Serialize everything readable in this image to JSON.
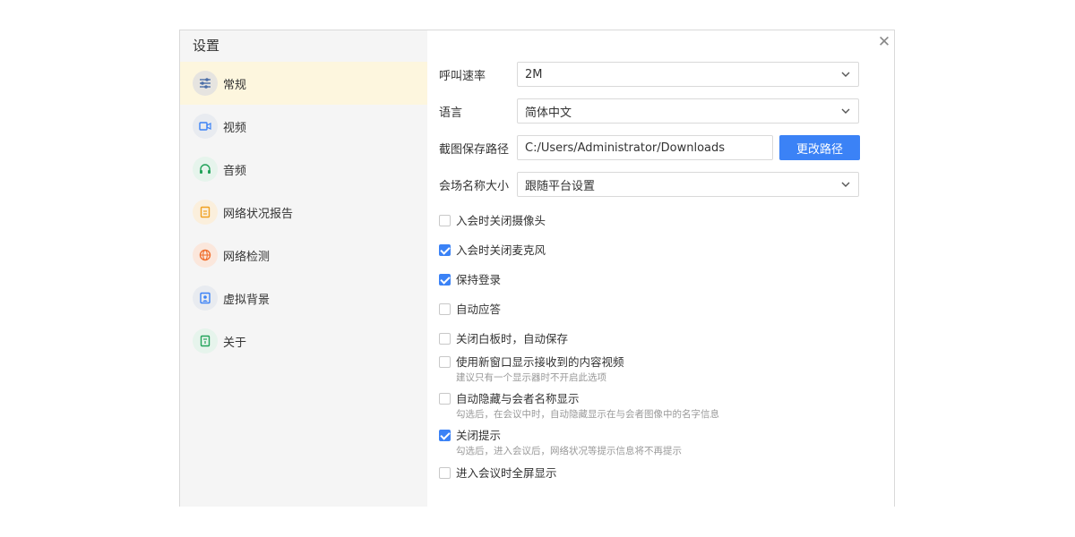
{
  "dialog": {
    "title": "设置"
  },
  "sidebar": {
    "items": [
      {
        "label": "常规",
        "icon": "sliders-icon",
        "active": true
      },
      {
        "label": "视频",
        "icon": "video-icon",
        "active": false
      },
      {
        "label": "音频",
        "icon": "headphones-icon",
        "active": false
      },
      {
        "label": "网络状况报告",
        "icon": "report-icon",
        "active": false
      },
      {
        "label": "网络检测",
        "icon": "globe-icon",
        "active": false
      },
      {
        "label": "虚拟背景",
        "icon": "portrait-icon",
        "active": false
      },
      {
        "label": "关于",
        "icon": "info-book-icon",
        "active": false
      }
    ]
  },
  "settings": {
    "call_rate": {
      "label": "呼叫速率",
      "value": "2M"
    },
    "language": {
      "label": "语言",
      "value": "简体中文"
    },
    "screenshot_path": {
      "label": "截图保存路径",
      "value": "C:/Users/Administrator/Downloads",
      "button": "更改路径"
    },
    "venue_name_size": {
      "label": "会场名称大小",
      "value": "跟随平台设置"
    }
  },
  "options": [
    {
      "label": "入会时关闭摄像头",
      "checked": false,
      "hint": ""
    },
    {
      "label": "入会时关闭麦克风",
      "checked": true,
      "hint": ""
    },
    {
      "label": "保持登录",
      "checked": true,
      "hint": ""
    },
    {
      "label": "自动应答",
      "checked": false,
      "hint": ""
    },
    {
      "label": "关闭白板时，自动保存",
      "checked": false,
      "hint": ""
    },
    {
      "label": "使用新窗口显示接收到的内容视频",
      "checked": false,
      "hint": "建议只有一个显示器时不开启此选项"
    },
    {
      "label": "自动隐藏与会者名称显示",
      "checked": false,
      "hint": "勾选后，在会议中时，自动隐藏显示在与会者图像中的名字信息"
    },
    {
      "label": "关闭提示",
      "checked": true,
      "hint": "勾选后，进入会议后，网络状况等提示信息将不再提示"
    },
    {
      "label": "进入会议时全屏显示",
      "checked": false,
      "hint": ""
    }
  ],
  "colors": {
    "accent": "#3b82f6",
    "active_bg": "#fdf6de",
    "sidebar_bg": "#f5f5f5"
  }
}
